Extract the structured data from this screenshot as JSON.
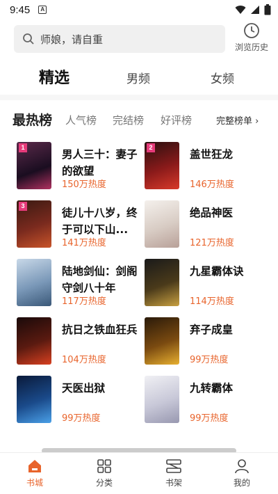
{
  "status_bar": {
    "time": "9:45",
    "notif_letter": "A"
  },
  "search": {
    "placeholder": "师娘，请自重",
    "history_label": "浏览历史"
  },
  "channels": [
    {
      "label": "精选",
      "active": true
    },
    {
      "label": "男频",
      "active": false
    },
    {
      "label": "女频",
      "active": false
    }
  ],
  "ranking": {
    "title": "最热榜",
    "tabs": [
      "人气榜",
      "完结榜",
      "好评榜"
    ],
    "more_label": "完整榜单 ›"
  },
  "books": [
    {
      "rank": "1",
      "name": "男人三十：妻子的欲望",
      "heat": "150万热度",
      "badge_color": "#e63b7a"
    },
    {
      "rank": "2",
      "name": "盖世狂龙",
      "heat": "146万热度",
      "badge_color": "#e63b7a"
    },
    {
      "rank": "3",
      "name": "徒儿十八岁，终于可以下山...",
      "heat": "141万热度",
      "badge_color": "#e63b7a"
    },
    {
      "rank": "",
      "name": "绝品神医",
      "heat": "121万热度",
      "badge_color": ""
    },
    {
      "rank": "",
      "name": "陆地剑仙：剑阁守剑八十年",
      "heat": "117万热度",
      "badge_color": ""
    },
    {
      "rank": "",
      "name": "九星霸体诀",
      "heat": "114万热度",
      "badge_color": ""
    },
    {
      "rank": "",
      "name": "抗日之铁血狂兵",
      "heat": "104万热度",
      "badge_color": ""
    },
    {
      "rank": "",
      "name": "弃子成皇",
      "heat": "99万热度",
      "badge_color": ""
    },
    {
      "rank": "",
      "name": "天医出狱",
      "heat": "99万热度",
      "badge_color": ""
    },
    {
      "rank": "",
      "name": "九转霸体",
      "heat": "99万热度",
      "badge_color": ""
    }
  ],
  "nav": [
    {
      "label": "书城",
      "icon": "home-icon",
      "active": true
    },
    {
      "label": "分类",
      "icon": "category-icon",
      "active": false
    },
    {
      "label": "书架",
      "icon": "bookshelf-icon",
      "active": false
    },
    {
      "label": "我的",
      "icon": "profile-icon",
      "active": false
    }
  ],
  "colors": {
    "accent": "#e8642c",
    "rank_badge": "#e63b7a"
  }
}
